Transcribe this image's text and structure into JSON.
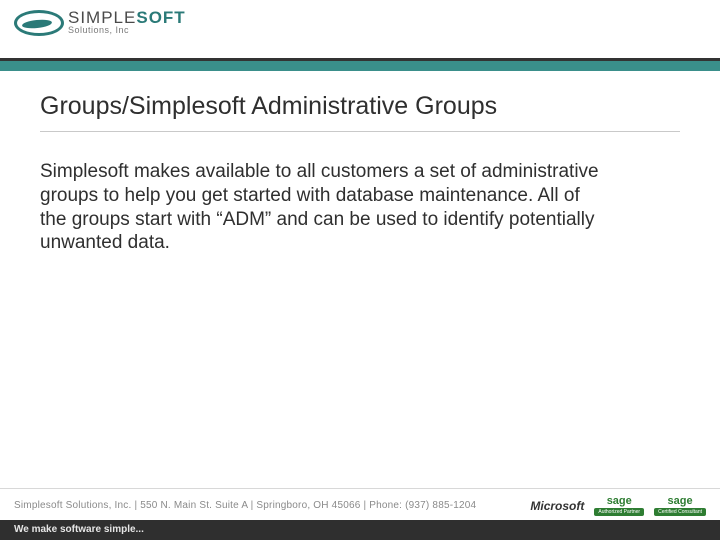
{
  "header": {
    "logo_word1": "SIMPLE",
    "logo_word2": "SOFT",
    "logo_sub": "Solutions, Inc"
  },
  "page": {
    "title": "Groups/Simplesoft Administrative Groups",
    "body": "Simplesoft makes available to all customers a set of administrative groups to help you get started with database maintenance.  All of the groups start with “ADM” and can be used to identify potentially unwanted data."
  },
  "footer": {
    "address": "Simplesoft Solutions, Inc.   |   550 N. Main St. Suite A   |   Springboro, OH 45066   |   Phone: (937) 885-1204",
    "microsoft": "Microsoft",
    "sage": "sage",
    "sage_tag1": "Authorized Partner",
    "sage_tag2": "Certified Consultant",
    "tagline": "We make software simple..."
  }
}
